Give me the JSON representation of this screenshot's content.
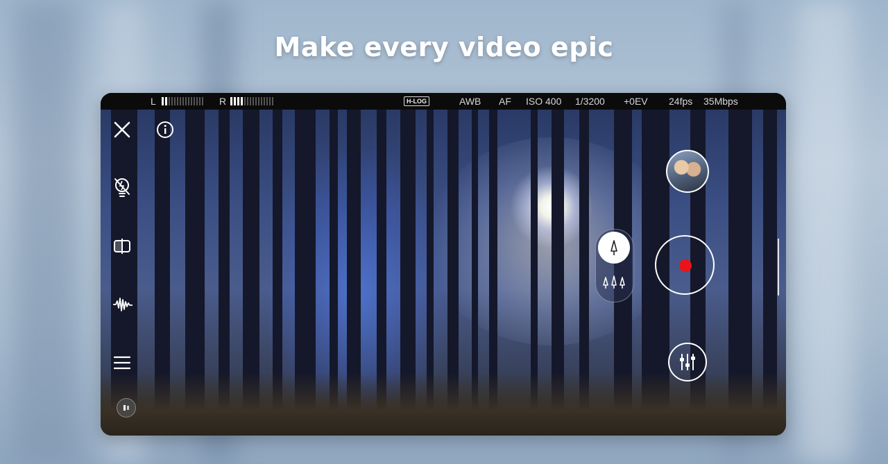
{
  "headline": "Make every video epic",
  "status_bar": {
    "left_channel": "L",
    "right_channel": "R",
    "left_level": 0.2,
    "right_level": 0.3,
    "hlog_badge": "H-LOG",
    "white_balance": "AWB",
    "focus_mode": "AF",
    "iso": "ISO 400",
    "shutter": "1/3200",
    "exposure": "+0EV",
    "framerate": "24fps",
    "bitrate": "35Mbps"
  },
  "controls": {
    "close_icon": "close-icon",
    "info_icon": "info-icon",
    "flash_icon": "flash-off-icon",
    "flip_icon": "flip-camera-icon",
    "audio_icon": "audio-waveform-icon",
    "menu_icon": "menu-icon",
    "record_icon": "record-icon",
    "settings_icon": "sliders-icon"
  },
  "colors": {
    "record_dot": "#e8141a",
    "status_bg": "#0b0b0b"
  }
}
